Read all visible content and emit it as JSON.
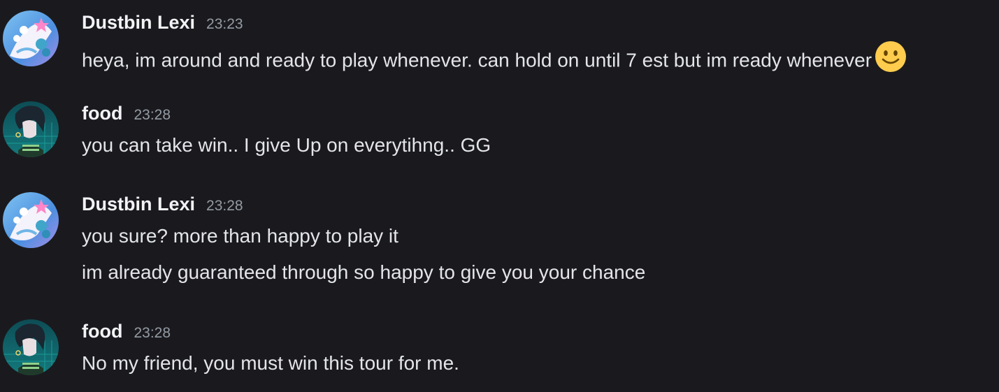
{
  "messages": [
    {
      "username": "Dustbin Lexi",
      "timestamp": "23:23",
      "avatar": "lexi-avatar",
      "lines": [
        "heya, im around and ready to play whenever. can hold on until 7 est but im ready whenever"
      ],
      "trailing_emoji": "slightly-smiling-face-emoji"
    },
    {
      "username": "food",
      "timestamp": "23:28",
      "avatar": "food-avatar",
      "lines": [
        "you can take win.. I give Up on everytihng.. GG"
      ]
    },
    {
      "username": "Dustbin Lexi",
      "timestamp": "23:28",
      "avatar": "lexi-avatar",
      "lines": [
        "you sure? more than happy to play it",
        "im already guaranteed through so happy to give you your chance"
      ]
    },
    {
      "username": "food",
      "timestamp": "23:28",
      "avatar": "food-avatar",
      "lines": [
        "No my friend, you must win this tour for me."
      ]
    }
  ],
  "colors": {
    "background": "#1a1a1e",
    "username": "#f2f3f5",
    "timestamp": "#949ba4",
    "message_text": "#e3e5e8",
    "emoji_face": "#ffcc4d"
  }
}
